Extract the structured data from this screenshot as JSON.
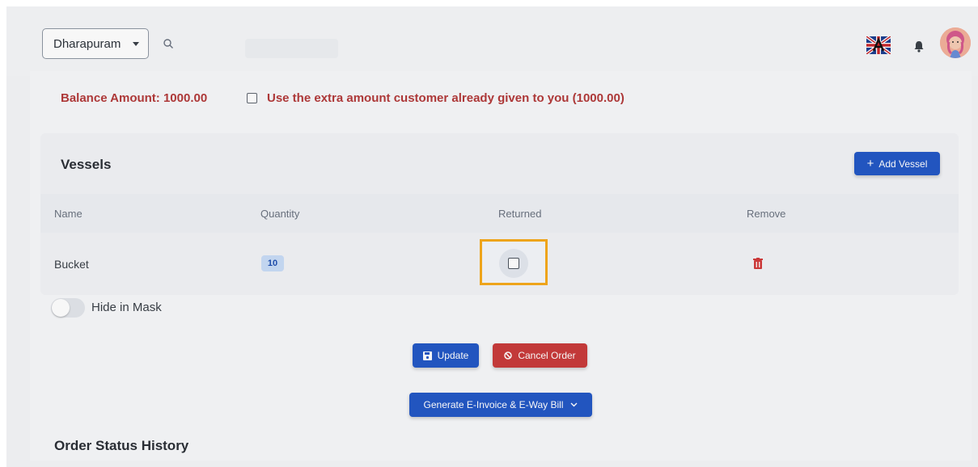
{
  "header": {
    "branch": "Dharapuram",
    "search_placeholder": ""
  },
  "payment": {
    "balance": "Balance Amount: 1000.00",
    "extra_amount_label": "Use the extra amount customer already given to you (1000.00)"
  },
  "vessels": {
    "title": "Vessels",
    "add_label": "Add Vessel",
    "columns": [
      "Name",
      "Quantity",
      "Returned",
      "Remove"
    ],
    "rows": [
      {
        "name": "Bucket",
        "quantity": "10"
      }
    ]
  },
  "mask": {
    "label": "Hide in Mask"
  },
  "actions": {
    "update": "Update",
    "cancel": "Cancel Order",
    "einvoice": "Generate E-Invoice & E-Way Bill"
  },
  "history": {
    "title": "Order Status History"
  },
  "colors": {
    "primary": "#2458c6",
    "danger": "#c93b3b",
    "warning_text": "#b33a3a",
    "highlight": "#f6aa1c"
  }
}
